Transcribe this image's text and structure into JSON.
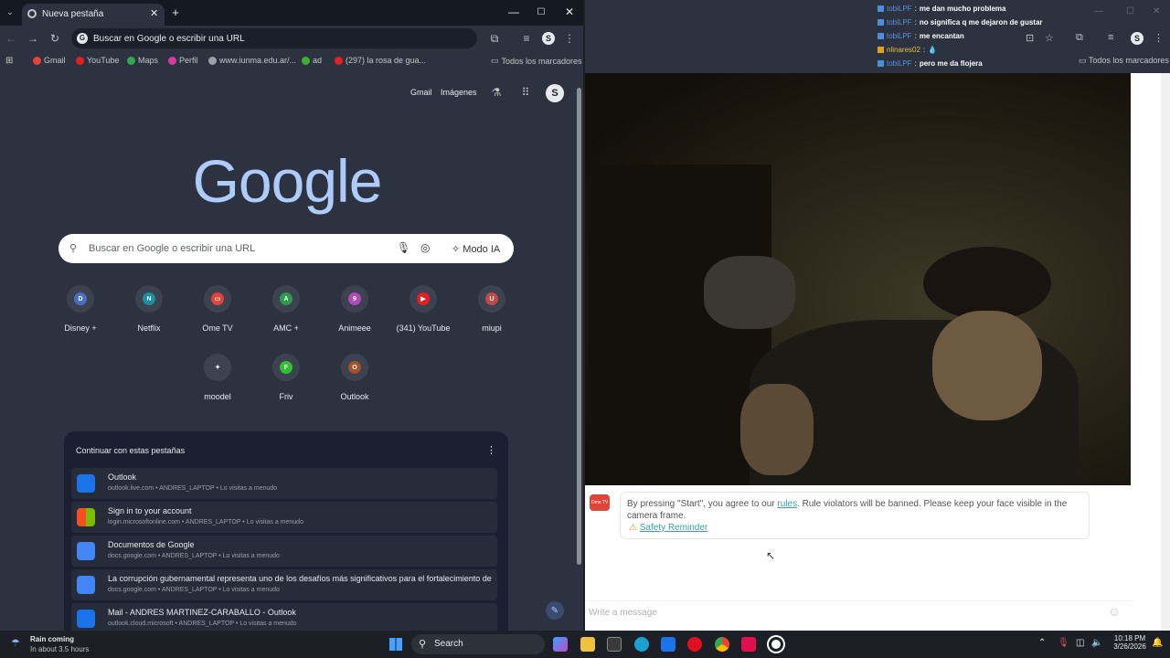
{
  "left_window": {
    "tab_title": "Nueva pestaña",
    "omnibox_text": "Buscar en Google o escribir una URL",
    "profile_letter": "S",
    "bookmarks": [
      "Gmail",
      "YouTube",
      "Maps",
      "Perfil",
      "www.iunma.edu.ar/...",
      "ad",
      "(297) la rosa de gua..."
    ],
    "all_bookmarks": "Todos los marcadores",
    "top_links": {
      "gmail": "Gmail",
      "images": "Imágenes"
    },
    "logo_text": "Google",
    "search_placeholder": "Buscar en Google o escribir una URL",
    "ai_mode": "Modo IA",
    "shortcuts": [
      {
        "label": "Disney +",
        "letter": "D",
        "color": "#4a6fc2"
      },
      {
        "label": "Netflix",
        "letter": "N",
        "color": "#1a8fa0"
      },
      {
        "label": "Ome TV",
        "letter": "▭",
        "color": "#e0453a"
      },
      {
        "label": "AMC +",
        "letter": "A",
        "color": "#2e9a4a"
      },
      {
        "label": "Animeee",
        "letter": "9",
        "color": "#b04ab8"
      },
      {
        "label": "(341) YouTube",
        "letter": "▶",
        "color": "#e52020"
      },
      {
        "label": "miupi",
        "letter": "U",
        "color": "#c04a4a"
      },
      {
        "label": "moodel",
        "letter": "✦",
        "color": "#3c4250"
      },
      {
        "label": "Friv",
        "letter": "F",
        "color": "#30c030"
      },
      {
        "label": "Outlook",
        "letter": "O",
        "color": "#a0522d"
      }
    ],
    "continue_title": "Continuar con estas pestañas",
    "continue_items": [
      {
        "title": "Outlook",
        "subtitle": "outlook.live.com • ANDRES_LAPTOP • Lo visitas a menudo",
        "color": "#1a73e8"
      },
      {
        "title": "Sign in to your account",
        "subtitle": "login.microsoftonline.com • ANDRES_LAPTOP • Lo visitas a menudo",
        "color": "#f25022"
      },
      {
        "title": "Documentos de Google",
        "subtitle": "docs.google.com • ANDRES_LAPTOP • Lo visitas a menudo",
        "color": "#4285f4"
      },
      {
        "title": "La corrupción gubernamental representa uno de los desafíos más significativos para el fortalecimiento de las...",
        "subtitle": "docs.google.com • ANDRES_LAPTOP • Lo visitas a menudo",
        "color": "#4285f4"
      },
      {
        "title": "Mail - ANDRES MARTINEZ-CARABALLO - Outlook",
        "subtitle": "outlook.cloud.microsoft • ANDRES_LAPTOP • Lo visitas a menudo",
        "color": "#1a73e8"
      }
    ]
  },
  "right_window": {
    "all_bookmarks": "Todos los marcadores",
    "profile_letter": "S",
    "chat": [
      {
        "user": "tobiLPF",
        "text": "me dan mucho problema"
      },
      {
        "user": "tobiLPF",
        "text": "no significa q me dejaron de gustar"
      },
      {
        "user": "tobiLPF",
        "text": "me encantan"
      },
      {
        "user": "nlinares02",
        "text": "💧"
      },
      {
        "user": "tobiLPF",
        "text": "pero me da flojera"
      }
    ],
    "notice_before": "By pressing \"Start\", you agree to our ",
    "notice_link": "rules",
    "notice_after": ". Rule violators will be banned. Please keep your face visible in the camera frame.",
    "safety": "Safety Reminder",
    "message_placeholder": "Write a message",
    "logo_text": "Ome TV"
  },
  "taskbar": {
    "weather_title": "Rain coming",
    "weather_sub": "In about 3.5 hours",
    "search": "Search",
    "time": "10:18 PM",
    "date": "3/26/2026"
  },
  "colors": {
    "accent": "#aecbfa",
    "link": "#3aa0a0"
  }
}
